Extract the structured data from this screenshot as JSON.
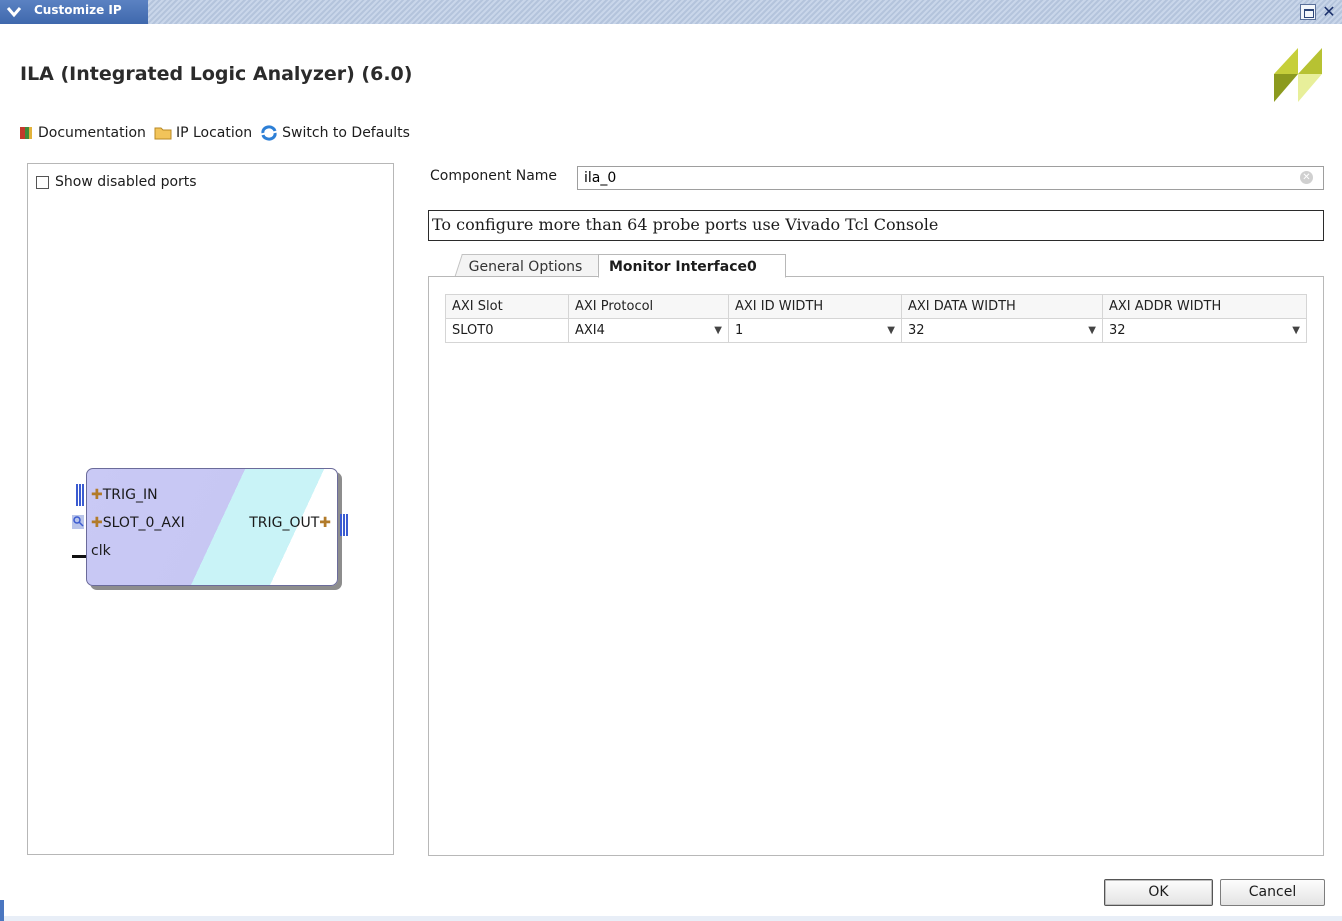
{
  "window": {
    "title": "Customize IP",
    "restore_icon": "window-restore-icon",
    "close_icon": "close-icon",
    "close_glyph": "✕"
  },
  "header": {
    "title": "ILA (Integrated Logic Analyzer) (6.0)",
    "logo": "xilinx-logo"
  },
  "toolbar": {
    "items": [
      {
        "label": "Documentation",
        "icon": "documentation-book-icon"
      },
      {
        "label": "IP Location",
        "icon": "folder-icon"
      },
      {
        "label": "Switch to Defaults",
        "icon": "refresh-icon"
      }
    ]
  },
  "left_panel": {
    "show_disabled_label": "Show disabled ports",
    "show_disabled_checked": false,
    "block": {
      "left_ports": [
        "TRIG_IN",
        "SLOT_0_AXI",
        "clk"
      ],
      "right_ports": [
        "TRIG_OUT"
      ]
    }
  },
  "component": {
    "label": "Component Name",
    "value": "ila_0"
  },
  "info_message": "To configure more than 64 probe ports use Vivado Tcl Console",
  "tabs": [
    {
      "label": "General Options",
      "active": false
    },
    {
      "label": "Monitor Interface0",
      "active": true
    }
  ],
  "axi_table": {
    "headers": [
      "AXI Slot",
      "AXI Protocol",
      "AXI ID WIDTH",
      "AXI DATA WIDTH",
      "AXI ADDR WIDTH"
    ],
    "rows": [
      {
        "slot": "SLOT0",
        "protocol": "AXI4",
        "id_width": "1",
        "data_width": "32",
        "addr_width": "32"
      }
    ]
  },
  "buttons": {
    "ok": "OK",
    "cancel": "Cancel"
  },
  "colors": {
    "titlebar": "#3f68ad",
    "block_fill": "#c9c9f5",
    "block_accent": "#c9f3f7",
    "bus_port": "#3b5bd0",
    "logo": "#a3b32a"
  }
}
